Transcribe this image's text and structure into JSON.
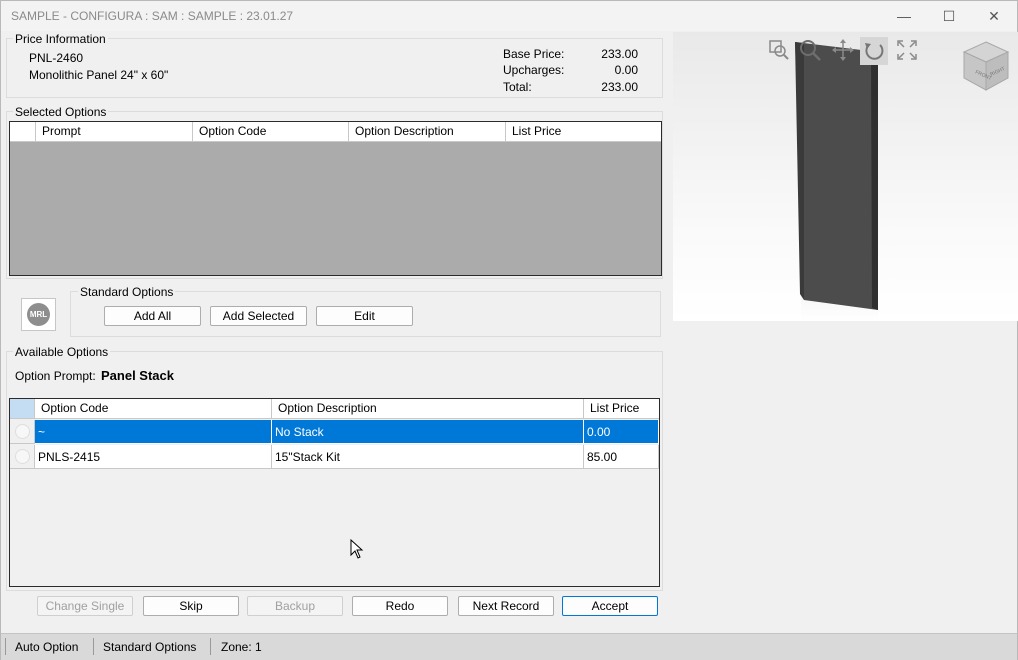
{
  "window": {
    "title": "SAMPLE - CONFIGURA : SAM : SAMPLE : 23.01.27",
    "minimize_glyph": "—",
    "maximize_glyph": "☐",
    "close_glyph": "✕"
  },
  "price_info": {
    "group_title": "Price Information",
    "item_code": "PNL-2460",
    "item_description": "Monolithic Panel 24\" x 60\"",
    "base_price_label": "Base Price:",
    "base_price": "233.00",
    "upcharges_label": "Upcharges:",
    "upcharges": "0.00",
    "total_label": "Total:",
    "total": "233.00"
  },
  "selected_options": {
    "group_title": "Selected Options",
    "columns": [
      "Prompt",
      "Option Code",
      "Option Description",
      "List Price"
    ]
  },
  "standard_options": {
    "group_title": "Standard Options",
    "logo_text": "MRL",
    "add_all_label": "Add All",
    "add_selected_label": "Add Selected",
    "edit_label": "Edit"
  },
  "available_options": {
    "group_title": "Available Options",
    "prompt_label": "Option Prompt:",
    "prompt_value": "Panel Stack",
    "columns": [
      "Option Code",
      "Option Description",
      "List Price"
    ],
    "rows": [
      {
        "code": "~",
        "description": "No Stack",
        "price": "0.00",
        "selected": true
      },
      {
        "code": "PNLS-2415",
        "description": "15\"Stack Kit",
        "price": "85.00",
        "selected": false
      }
    ]
  },
  "actions": {
    "change_single_label": "Change Single",
    "skip_label": "Skip",
    "backup_label": "Backup",
    "redo_label": "Redo",
    "next_record_label": "Next Record",
    "accept_label": "Accept"
  },
  "status_bar": {
    "mode": "Auto Option",
    "section": "Standard Options",
    "zone": "Zone: 1"
  },
  "viewer": {
    "tools": [
      "zoom-window-icon",
      "zoom-icon",
      "pan-icon",
      "rotate-icon",
      "fit-view-icon"
    ],
    "view_cube_faces": [
      "FRONT",
      "RIGHT"
    ]
  },
  "colors": {
    "selection": "#0078d7",
    "grid_empty": "#ababab",
    "panel_dark": "#4a4a4a"
  }
}
